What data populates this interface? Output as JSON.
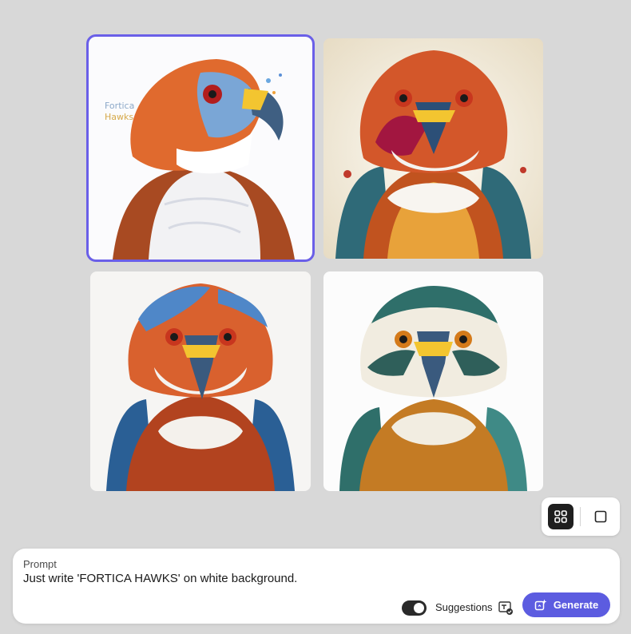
{
  "gallery": {
    "images": [
      {
        "subject": "hawk illustration with orange head and white chest",
        "selected": true,
        "watermark_text": "Fortica Hawks"
      },
      {
        "subject": "hawk illustration with red-orange head and teal wings",
        "selected": false
      },
      {
        "subject": "hawk illustration with blue-orange head",
        "selected": false
      },
      {
        "subject": "hawk illustration with teal head and orange chest",
        "selected": false
      }
    ]
  },
  "view_toggle": {
    "grid_icon": "grid-icon",
    "single_icon": "square-icon",
    "active": "grid"
  },
  "prompt": {
    "label": "Prompt",
    "text": "Just write 'FORTICA HAWKS' on white background.",
    "suggestions_label": "Suggestions",
    "suggestions_on": true,
    "generate_label": "Generate"
  },
  "colors": {
    "accent": "#5c5ce0",
    "selection_outline": "#6a5fe8",
    "background": "#d8d8d8"
  }
}
